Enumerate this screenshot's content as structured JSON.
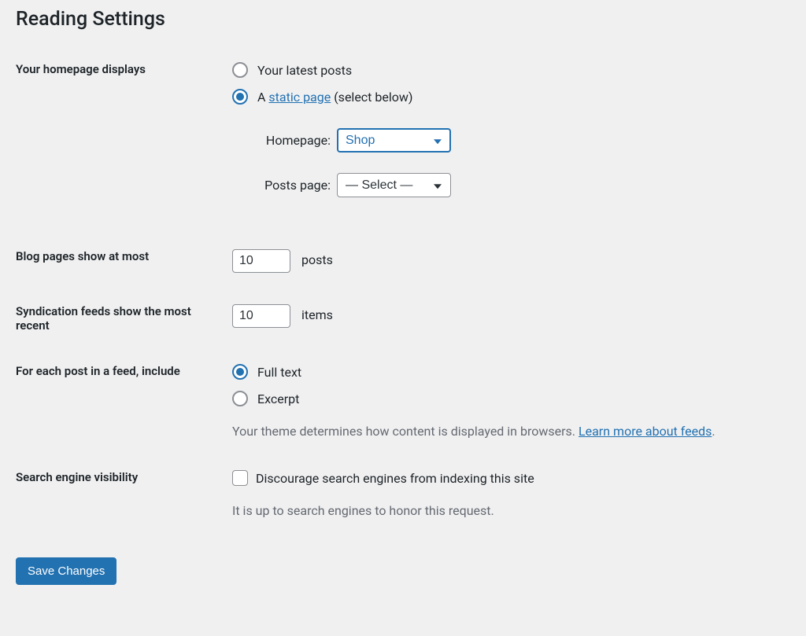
{
  "page": {
    "title": "Reading Settings"
  },
  "homepage_displays": {
    "label": "Your homepage displays",
    "option_latest": "Your latest posts",
    "option_static_prefix": "A ",
    "option_static_link": "static page",
    "option_static_suffix": " (select below)",
    "homepage_label": "Homepage:",
    "homepage_value": "Shop",
    "posts_page_label": "Posts page:",
    "posts_page_value": "— Select —"
  },
  "blog_pages": {
    "label": "Blog pages show at most",
    "value": "10",
    "suffix": "posts"
  },
  "syndication": {
    "label": "Syndication feeds show the most recent",
    "value": "10",
    "suffix": "items"
  },
  "feed_include": {
    "label": "For each post in a feed, include",
    "option_full": "Full text",
    "option_excerpt": "Excerpt",
    "description_prefix": "Your theme determines how content is displayed in browsers. ",
    "description_link": "Learn more about feeds",
    "description_suffix": "."
  },
  "search_visibility": {
    "label": "Search engine visibility",
    "checkbox_label": "Discourage search engines from indexing this site",
    "description": "It is up to search engines to honor this request."
  },
  "submit": {
    "label": "Save Changes"
  }
}
